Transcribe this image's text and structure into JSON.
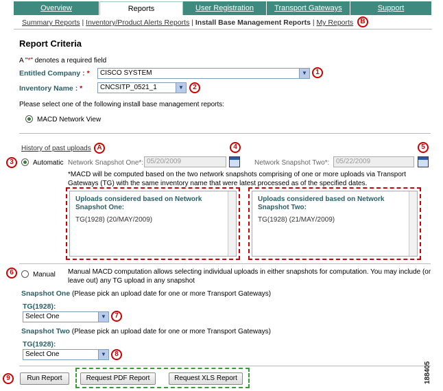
{
  "tabs": [
    "Overview",
    "Reports",
    "User Registration",
    "Transport Gateways",
    "Support"
  ],
  "subnav": {
    "link1": "Summary Reports",
    "link2": "Inventory/Product Alerts Reports",
    "current": "Install Base Management Reports",
    "link3": "My Reports"
  },
  "title": "Report Criteria",
  "required_note_a": "A \"",
  "required_note_star": "*",
  "required_note_b": "\" denotes a required field",
  "entitled_company": {
    "label": "Entitled Company :",
    "value": "CISCO SYSTEM"
  },
  "inventory_name": {
    "label": "Inventory Name :",
    "value": "CNCSITP_0521_1"
  },
  "select_prompt": "Please select one of the following install base management reports:",
  "report_option": "MACD Network View",
  "history_link": "History of past uploads",
  "automatic": {
    "label": "Automatic",
    "snap1_label": "Network Snapshot One*:",
    "snap1_value": "05/20/2009",
    "snap2_label": "Network Snapshot Two*:",
    "snap2_value": "05/22/2009",
    "note": "*MACD will be computed based on the two network snapshots comprising of one or more uploads via Transport Gateways (TG) with the same inventory name that were latest processed as of the specified dates."
  },
  "panel1": {
    "title": "Uploads considered based on Network Snapshot One:",
    "value": "TG(1928) (20/MAY/2009)"
  },
  "panel2": {
    "title": "Uploads considered based on Network Snapshot Two:",
    "value": "TG(1928) (21/MAY/2009)"
  },
  "manual": {
    "label": "Manual",
    "desc": "Manual MACD computation allows selecting individual uploads in either snapshots for computation. You may include (or leave out) any TG upload in any snapshot"
  },
  "snapshot_one": {
    "label": "Snapshot One",
    "hint": "(Please pick an upload date for one or more Transport Gateways)",
    "tg": "TG(1928):",
    "value": "Select One"
  },
  "snapshot_two": {
    "label": "Snapshot Two",
    "hint": "(Please pick an upload date for one or more Transport Gateways)",
    "tg": "TG(1928):",
    "value": "Select One"
  },
  "buttons": {
    "run": "Run Report",
    "pdf": "Request PDF Report",
    "xls": "Request XLS Report"
  },
  "callouts": {
    "c1": "1",
    "c2": "2",
    "c3": "3",
    "c4": "4",
    "c5": "5",
    "c6": "6",
    "c7": "7",
    "c8": "8",
    "c9": "9",
    "cA": "A",
    "cB": "B"
  },
  "figure_id": "188405",
  "colors": {
    "tab_bg": "#3f8a7e",
    "teal_label": "#2b5f66",
    "callout_red": "#cc0000",
    "green_dash": "#3a9a3a"
  }
}
